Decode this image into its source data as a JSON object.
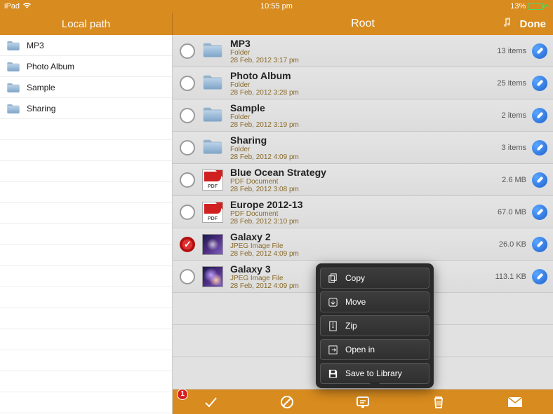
{
  "status": {
    "device": "iPad",
    "time": "10:55 pm",
    "battery_pct": "13%"
  },
  "sidebar": {
    "title": "Local path",
    "items": [
      {
        "label": "MP3"
      },
      {
        "label": "Photo Album"
      },
      {
        "label": "Sample"
      },
      {
        "label": "Sharing"
      }
    ]
  },
  "header": {
    "title": "Root",
    "done": "Done"
  },
  "rows": [
    {
      "name": "MP3",
      "kind": "Folder",
      "date": "28 Feb, 2012 3:17 pm",
      "meta": "13 items",
      "type": "folder",
      "selected": false
    },
    {
      "name": "Photo Album",
      "kind": "Folder",
      "date": "28 Feb, 2012 3:28 pm",
      "meta": "25 items",
      "type": "folder",
      "selected": false
    },
    {
      "name": "Sample",
      "kind": "Folder",
      "date": "28 Feb, 2012 3:19 pm",
      "meta": "2 items",
      "type": "folder",
      "selected": false
    },
    {
      "name": "Sharing",
      "kind": "Folder",
      "date": "28 Feb, 2012 4:09 pm",
      "meta": "3 items",
      "type": "folder",
      "selected": false
    },
    {
      "name": "Blue Ocean Strategy",
      "kind": "PDF Document",
      "date": "28 Feb, 2012 3:08 pm",
      "meta": "2.6 MB",
      "type": "pdf",
      "selected": false
    },
    {
      "name": "Europe 2012-13",
      "kind": "PDF Document",
      "date": "28 Feb, 2012 3:10 pm",
      "meta": "67.0 MB",
      "type": "pdf",
      "selected": false
    },
    {
      "name": "Galaxy 2",
      "kind": "JPEG Image File",
      "date": "28 Feb, 2012 4:09 pm",
      "meta": "26.0 KB",
      "type": "img2",
      "selected": true
    },
    {
      "name": "Galaxy 3",
      "kind": "JPEG Image File",
      "date": "28 Feb, 2012 4:09 pm",
      "meta": "113.1 KB",
      "type": "img3",
      "selected": false
    }
  ],
  "popover": {
    "items": [
      {
        "label": "Copy"
      },
      {
        "label": "Move"
      },
      {
        "label": "Zip"
      },
      {
        "label": "Open in"
      },
      {
        "label": "Save to Library"
      }
    ]
  },
  "toolbar": {
    "badge": "1"
  },
  "pdf_label": "PDF"
}
